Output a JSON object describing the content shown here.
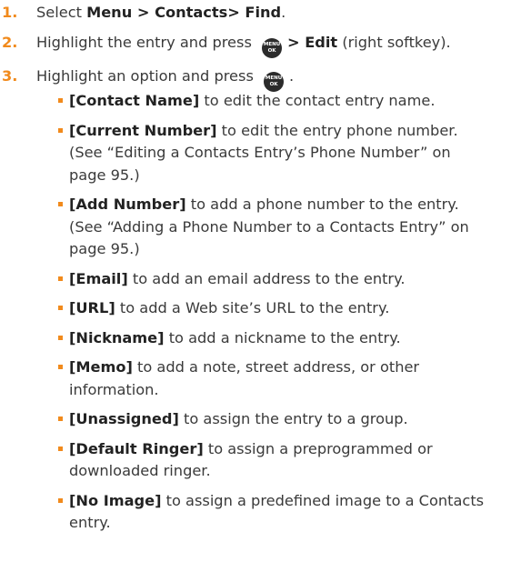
{
  "steps": [
    {
      "num": "1.",
      "pre": "Select ",
      "bold": "Menu > Contacts> Find",
      "post": "."
    },
    {
      "num": "2.",
      "pre": "Highlight the entry and press ",
      "key": "menu-ok-key",
      "bold": "> Edit",
      "post": " (right softkey)."
    },
    {
      "num": "3.",
      "pre": "Highlight an option and press ",
      "key": "menu-ok-key",
      "post": "."
    }
  ],
  "menu_key": {
    "line1": "MENU",
    "line2": "OK"
  },
  "options": [
    {
      "bold": "[Contact Name]",
      "text": " to edit the contact entry name."
    },
    {
      "bold": "[Current Number]",
      "text": " to edit the entry phone number. (See “Editing a Contacts Entry’s Phone Number” on page 95.)"
    },
    {
      "bold": "[Add Number]",
      "text": " to add a phone number to the entry. (See “Adding a Phone Number to a Contacts Entry” on page 95.)"
    },
    {
      "bold": "[Email]",
      "text": " to add an email address to the entry."
    },
    {
      "bold": "[URL]",
      "text": " to add a Web site’s URL to the entry."
    },
    {
      "bold": "[Nickname]",
      "text": " to add a nickname to the entry."
    },
    {
      "bold": "[Memo]",
      "text": " to add a note, street address, or other information."
    },
    {
      "bold": "[Unassigned]",
      "text": " to assign the entry to a group."
    },
    {
      "bold": "[Default Ringer]",
      "text": " to assign a preprogrammed or downloaded ringer."
    },
    {
      "bold": "[No Image]",
      "text": " to assign a predefined image to a Contacts entry."
    }
  ]
}
